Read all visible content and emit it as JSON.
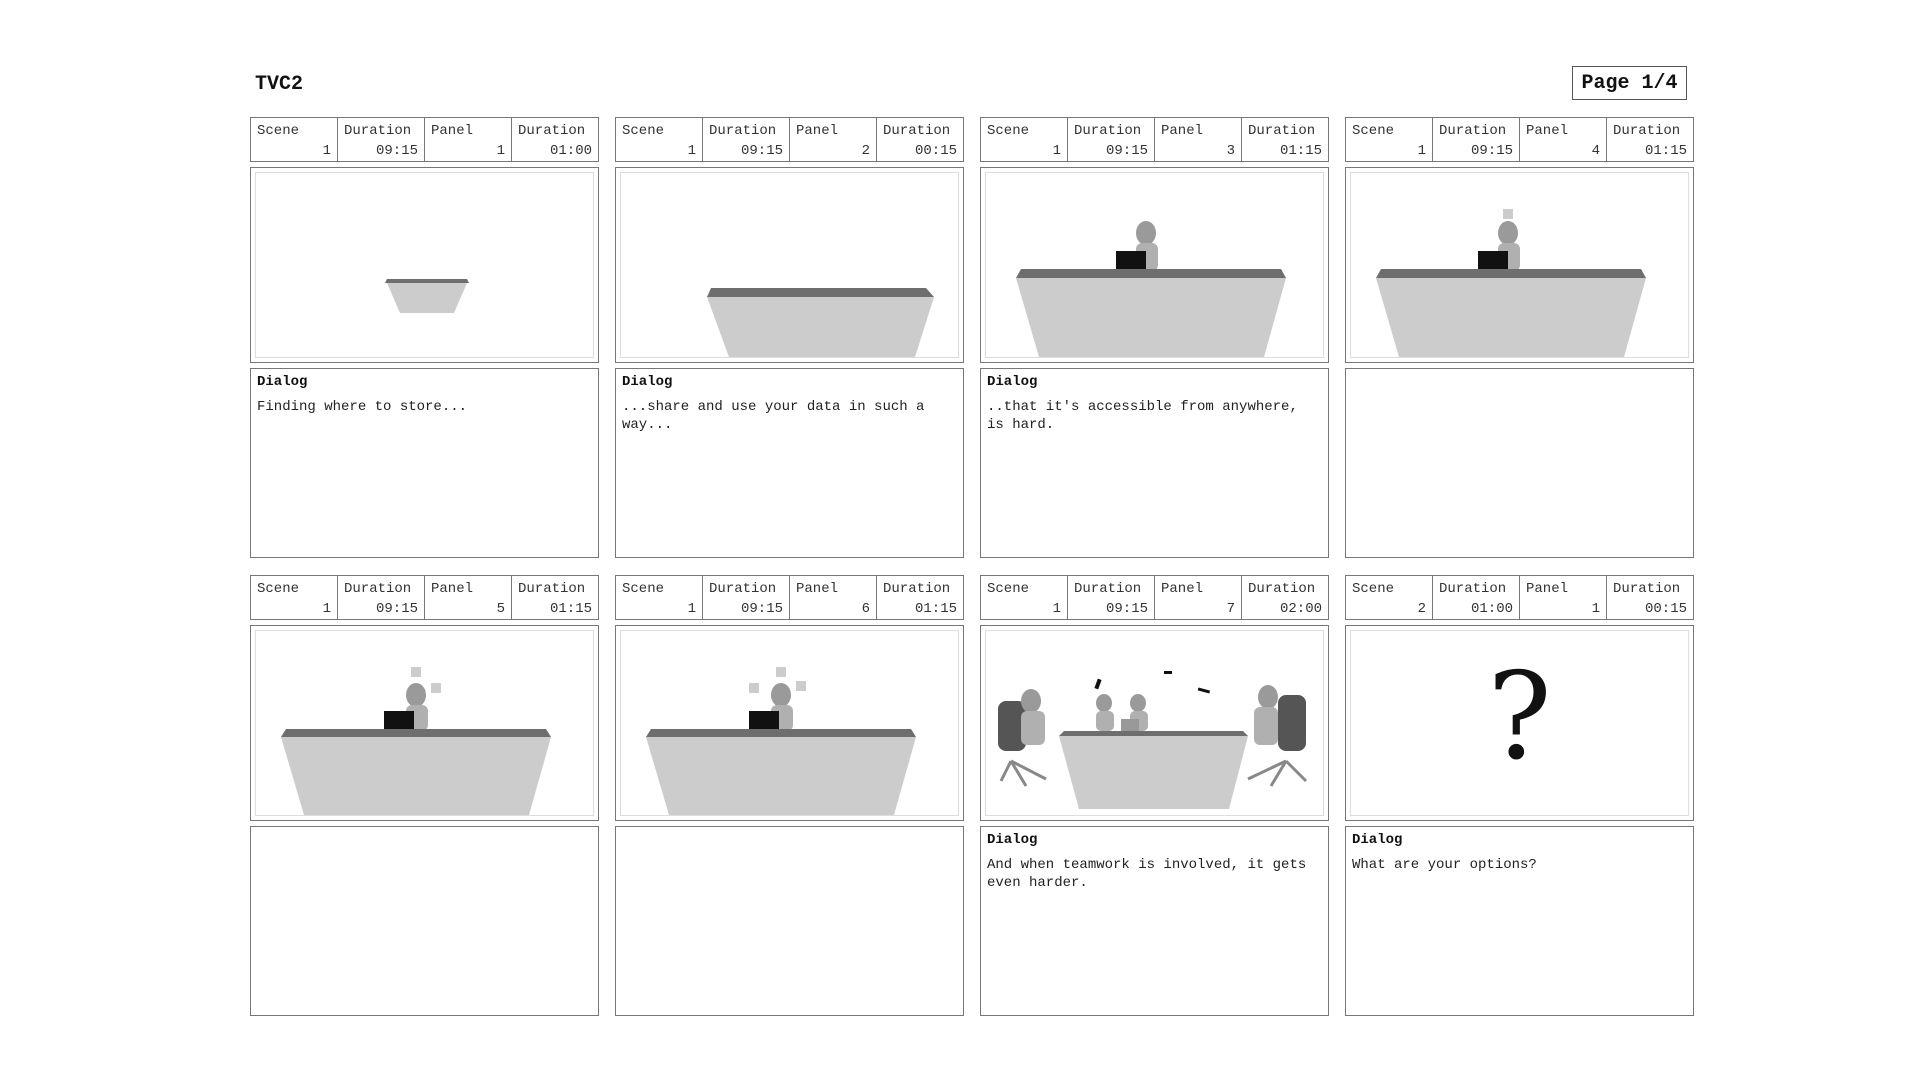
{
  "header": {
    "title": "TVC2",
    "page": "Page 1/4"
  },
  "labels": {
    "scene": "Scene",
    "duration": "Duration",
    "panel": "Panel",
    "dialog": "Dialog"
  },
  "panels": [
    {
      "scene": "1",
      "scene_duration": "09:15",
      "panel": "1",
      "panel_duration": "01:00",
      "dialog_label": "Dialog",
      "dialog": "Finding where to store..."
    },
    {
      "scene": "1",
      "scene_duration": "09:15",
      "panel": "2",
      "panel_duration": "00:15",
      "dialog_label": "Dialog",
      "dialog": "...share and use your data in such a way..."
    },
    {
      "scene": "1",
      "scene_duration": "09:15",
      "panel": "3",
      "panel_duration": "01:15",
      "dialog_label": "Dialog",
      "dialog": "..that it's accessible from anywhere, is hard."
    },
    {
      "scene": "1",
      "scene_duration": "09:15",
      "panel": "4",
      "panel_duration": "01:15",
      "dialog_label": "",
      "dialog": ""
    },
    {
      "scene": "1",
      "scene_duration": "09:15",
      "panel": "5",
      "panel_duration": "01:15",
      "dialog_label": "",
      "dialog": ""
    },
    {
      "scene": "1",
      "scene_duration": "09:15",
      "panel": "6",
      "panel_duration": "01:15",
      "dialog_label": "",
      "dialog": ""
    },
    {
      "scene": "1",
      "scene_duration": "09:15",
      "panel": "7",
      "panel_duration": "02:00",
      "dialog_label": "Dialog",
      "dialog": "And when teamwork is involved, it gets even harder."
    },
    {
      "scene": "2",
      "scene_duration": "01:00",
      "panel": "1",
      "panel_duration": "00:15",
      "dialog_label": "Dialog",
      "dialog": "What are your options?"
    }
  ],
  "panel8_symbol": "?",
  "colors": {
    "table_top": "#6e6e6e",
    "table_base": "#cccccc",
    "laptop": "#111111",
    "figure": "#aaaaaa",
    "border": "#777777"
  }
}
